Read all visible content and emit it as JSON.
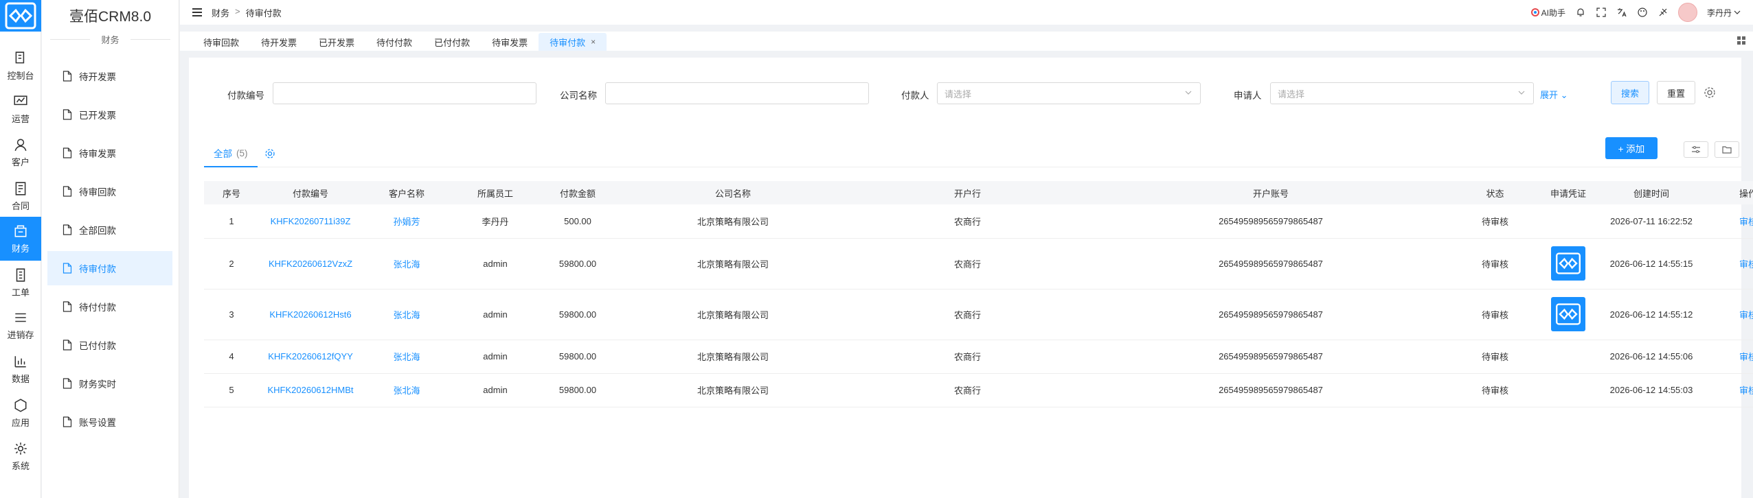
{
  "brand": "壹佰CRM8.0",
  "section_title": "财务",
  "rail": [
    {
      "label": "控制台",
      "icon": "dashboard-icon"
    },
    {
      "label": "运营",
      "icon": "operation-icon"
    },
    {
      "label": "客户",
      "icon": "customer-icon"
    },
    {
      "label": "合同",
      "icon": "contract-icon"
    },
    {
      "label": "财务",
      "icon": "finance-icon",
      "active": true
    },
    {
      "label": "工单",
      "icon": "ticket-icon"
    },
    {
      "label": "进销存",
      "icon": "inventory-icon"
    },
    {
      "label": "数据",
      "icon": "data-icon"
    },
    {
      "label": "应用",
      "icon": "app-icon"
    },
    {
      "label": "系统",
      "icon": "system-icon"
    }
  ],
  "menu": [
    {
      "label": "待开发票"
    },
    {
      "label": "已开发票"
    },
    {
      "label": "待审发票"
    },
    {
      "label": "待审回款"
    },
    {
      "label": "全部回款"
    },
    {
      "label": "待审付款",
      "active": true
    },
    {
      "label": "待付付款"
    },
    {
      "label": "已付付款"
    },
    {
      "label": "财务实时"
    },
    {
      "label": "账号设置"
    }
  ],
  "breadcrumb": {
    "root": "财务",
    "sep": ">",
    "current": "待审付款"
  },
  "topbar": {
    "ai": "AI助手",
    "user": "李丹丹"
  },
  "tabs": [
    "待审回款",
    "待开发票",
    "已开发票",
    "待付付款",
    "已付付款",
    "待审发票",
    "待审付款"
  ],
  "tab_close": "×",
  "filters": {
    "pay_no_label": "付款编号",
    "company_label": "公司名称",
    "payer_label": "付款人",
    "payer_placeholder": "请选择",
    "applicant_label": "申请人",
    "applicant_placeholder": "请选择",
    "expand": "展开",
    "search": "搜索",
    "reset": "重置"
  },
  "list": {
    "tab_all": "全部",
    "count": "(5)",
    "add": "+ 添加"
  },
  "columns": [
    "序号",
    "付款编号",
    "客户名称",
    "所属员工",
    "付款金额",
    "公司名称",
    "开户行",
    "开户账号",
    "状态",
    "申请凭证",
    "创建时间",
    "操作"
  ],
  "rows": [
    {
      "no": "1",
      "code": "KHFK20260711i39Z",
      "customer": "孙娟芳",
      "staff": "李丹丹",
      "amount": "500.00",
      "company": "北京策略有限公司",
      "bank": "农商行",
      "account": "265495989565979865487",
      "status": "待审核",
      "voucher": false,
      "created": "2026-07-11 16:22:52",
      "action": "审核"
    },
    {
      "no": "2",
      "code": "KHFK20260612VzxZ",
      "customer": "张北海",
      "staff": "admin",
      "amount": "59800.00",
      "company": "北京策略有限公司",
      "bank": "农商行",
      "account": "265495989565979865487",
      "status": "待审核",
      "voucher": true,
      "created": "2026-06-12 14:55:15",
      "action": "审核"
    },
    {
      "no": "3",
      "code": "KHFK20260612Hst6",
      "customer": "张北海",
      "staff": "admin",
      "amount": "59800.00",
      "company": "北京策略有限公司",
      "bank": "农商行",
      "account": "265495989565979865487",
      "status": "待审核",
      "voucher": true,
      "created": "2026-06-12 14:55:12",
      "action": "审核"
    },
    {
      "no": "4",
      "code": "KHFK20260612fQYY",
      "customer": "张北海",
      "staff": "admin",
      "amount": "59800.00",
      "company": "北京策略有限公司",
      "bank": "农商行",
      "account": "265495989565979865487",
      "status": "待审核",
      "voucher": false,
      "created": "2026-06-12 14:55:06",
      "action": "审核"
    },
    {
      "no": "5",
      "code": "KHFK20260612HMBt",
      "customer": "张北海",
      "staff": "admin",
      "amount": "59800.00",
      "company": "北京策略有限公司",
      "bank": "农商行",
      "account": "265495989565979865487",
      "status": "待审核",
      "voucher": false,
      "created": "2026-06-12 14:55:03",
      "action": "审核"
    }
  ],
  "colors": {
    "accent": "#1890ff",
    "active_bg": "#e8f3ff"
  }
}
